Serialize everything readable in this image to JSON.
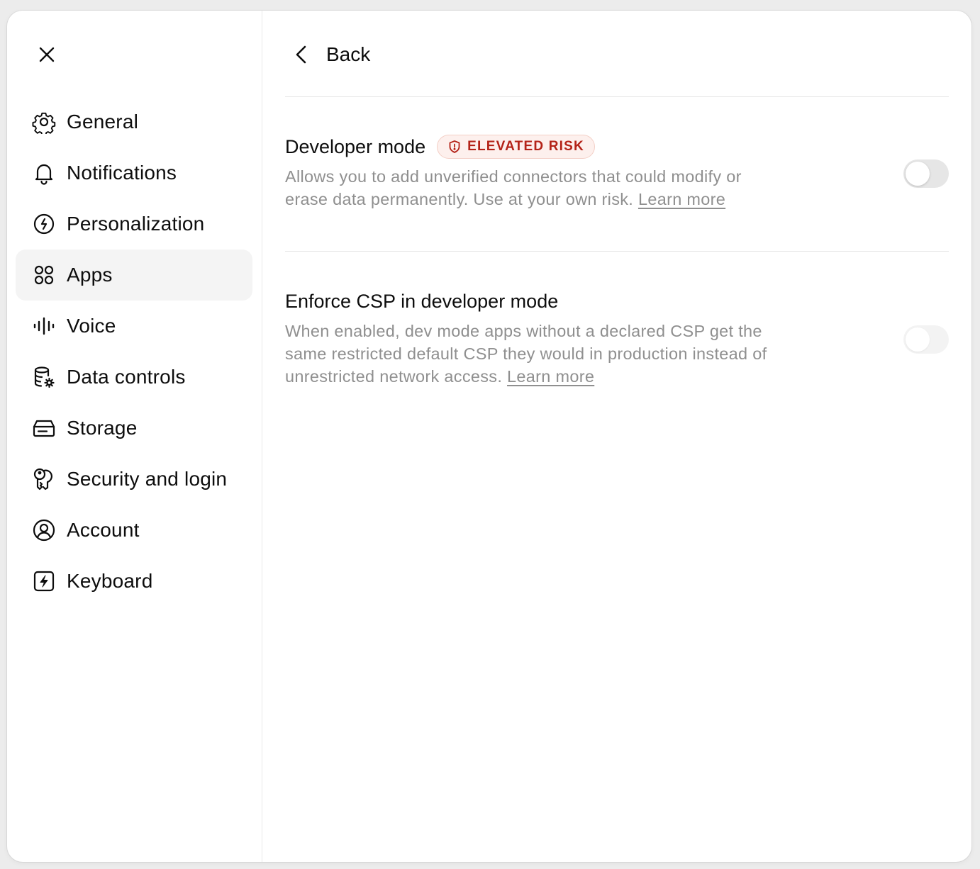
{
  "sidebar": {
    "close_icon": "close-icon",
    "items": [
      {
        "label": "General",
        "icon": "gear-icon",
        "active": false
      },
      {
        "label": "Notifications",
        "icon": "bell-icon",
        "active": false
      },
      {
        "label": "Personalization",
        "icon": "personalization-icon",
        "active": false
      },
      {
        "label": "Apps",
        "icon": "apps-grid-icon",
        "active": true
      },
      {
        "label": "Voice",
        "icon": "voice-waveform-icon",
        "active": false
      },
      {
        "label": "Data controls",
        "icon": "database-gear-icon",
        "active": false
      },
      {
        "label": "Storage",
        "icon": "storage-drive-icon",
        "active": false
      },
      {
        "label": "Security and login",
        "icon": "keys-icon",
        "active": false
      },
      {
        "label": "Account",
        "icon": "user-circle-icon",
        "active": false
      },
      {
        "label": "Keyboard",
        "icon": "keyboard-bolt-icon",
        "active": false
      }
    ]
  },
  "main": {
    "back_label": "Back",
    "settings": [
      {
        "title": "Developer mode",
        "badge": "ELEVATED RISK",
        "description": "Allows you to add unverified connectors that could modify or erase data permanently. Use at your own risk.",
        "link": "Learn more",
        "enabled": false
      },
      {
        "title": "Enforce CSP in developer mode",
        "description": "When enabled, dev mode apps without a declared CSP get the same restricted default CSP they would in production instead of unrestricted network access.",
        "link": "Learn more",
        "enabled": false,
        "disabled": true
      }
    ]
  },
  "colors": {
    "badge_text": "#b42318",
    "badge_bg": "#fdf0ed",
    "active_nav_bg": "#f4f4f4",
    "muted_text": "#8f8f8f"
  }
}
